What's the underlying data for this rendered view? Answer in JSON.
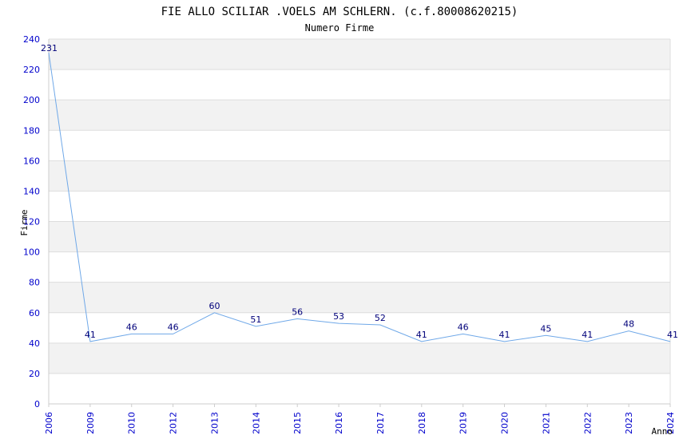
{
  "chart_data": {
    "type": "line",
    "title": "FIE ALLO SCILIAR .VOELS AM SCHLERN. (c.f.80008620215)",
    "subtitle": "Numero Firme",
    "xlabel": "Anno",
    "ylabel": "Firme",
    "categories": [
      "2006",
      "2009",
      "2010",
      "2012",
      "2013",
      "2014",
      "2015",
      "2016",
      "2017",
      "2018",
      "2019",
      "2020",
      "2021",
      "2022",
      "2023",
      "2024"
    ],
    "series": [
      {
        "values": [
          231,
          41,
          46,
          46,
          60,
          51,
          56,
          53,
          52,
          41,
          46,
          41,
          45,
          41,
          48,
          41
        ]
      }
    ],
    "ylim": [
      0,
      240
    ],
    "ytick_step": 20,
    "grid": true,
    "data_labels": true,
    "colors": {
      "line": "#6fa8e8",
      "tick_text": "#0000cc",
      "label_text": "#00007a",
      "band": "#f2f2f2",
      "grid": "#dddddd",
      "axis": "#cccccc"
    }
  }
}
